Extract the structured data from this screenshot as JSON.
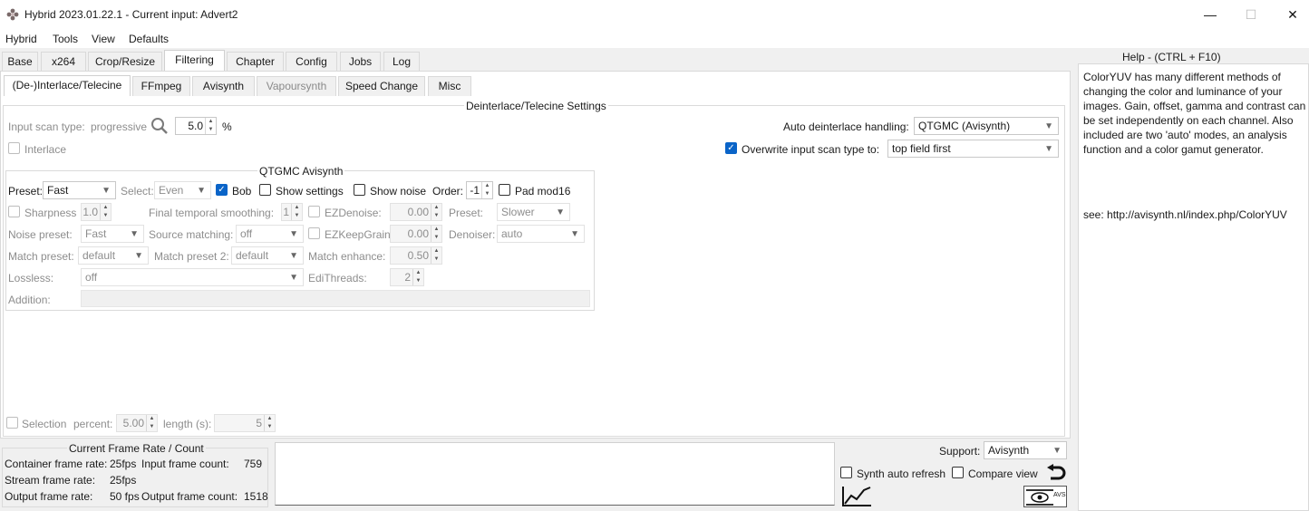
{
  "window": {
    "title": "Hybrid 2023.01.22.1 - Current input: Advert2",
    "minimize": "—",
    "maximize": "☐",
    "close": "✕"
  },
  "menu": [
    "Hybrid",
    "Tools",
    "View",
    "Defaults"
  ],
  "main_tabs": [
    "Base",
    "x264",
    "Crop/Resize",
    "Filtering",
    "Chapter",
    "Config",
    "Jobs",
    "Log"
  ],
  "sub_tabs": [
    "(De-)Interlace/Telecine",
    "FFmpeg",
    "Avisynth",
    "Vapoursynth",
    "Speed Change",
    "Misc"
  ],
  "deinterlace": {
    "title": "Deinterlace/Telecine Settings",
    "input_scan_label": "Input scan type:",
    "input_scan_value": "progressive",
    "zoom_value": "5.0",
    "percent": "%",
    "interlace_label": "Interlace",
    "auto_label": "Auto deinterlace handling:",
    "auto_value": "QTGMC (Avisynth)",
    "overwrite_label": "Overwrite input scan type to:",
    "overwrite_value": "top field first"
  },
  "qtgmc": {
    "title": "QTGMC Avisynth",
    "preset_label": "Preset:",
    "preset_value": "Fast",
    "select_label": "Select:",
    "select_value": "Even",
    "bob_label": "Bob",
    "show_settings_label": "Show settings",
    "show_noise_label": "Show noise",
    "order_label": "Order:",
    "order_value": "-1",
    "pad_label": "Pad mod16",
    "sharpness_label": "Sharpness",
    "sharpness_value": "1.0",
    "final_temporal_label": "Final temporal smoothing:",
    "final_temporal_value": "1",
    "ezdenoise_label": "EZDenoise:",
    "ezdenoise_value": "0.00",
    "preset2_label": "Preset:",
    "preset2_value": "Slower",
    "noise_preset_label": "Noise preset:",
    "noise_preset_value": "Fast",
    "source_matching_label": "Source matching:",
    "source_matching_value": "off",
    "ezkeepgrain_label": "EZKeepGrain:",
    "ezkeepgrain_value": "0.00",
    "denoiser_label": "Denoiser:",
    "denoiser_value": "auto",
    "match_preset_label": "Match preset:",
    "match_preset_value": "default",
    "match_preset2_label": "Match preset 2:",
    "match_preset2_value": "default",
    "match_enhance_label": "Match enhance:",
    "match_enhance_value": "0.50",
    "lossless_label": "Lossless:",
    "lossless_value": "off",
    "edithreads_label": "EdiThreads:",
    "edithreads_value": "2",
    "addition_label": "Addition:"
  },
  "selection": {
    "label": "Selection",
    "percent_label": "percent:",
    "percent_value": "5.00",
    "length_label": "length (s):",
    "length_value": "5"
  },
  "frame_rate": {
    "title": "Current Frame Rate / Count",
    "container_label": "Container frame rate:",
    "container_value": "25fps",
    "input_count_label": "Input frame count:",
    "input_count_value": "759",
    "stream_label": "Stream frame rate:",
    "stream_value": "25fps",
    "output_label": "Output frame rate:",
    "output_value": "50 fps",
    "output_count_label": "Output frame count:",
    "output_count_value": "1518"
  },
  "bottom_right": {
    "support_label": "Support:",
    "support_value": "Avisynth",
    "synth_refresh_label": "Synth auto refresh",
    "compare_label": "Compare view",
    "avs_label": "AVS"
  },
  "help": {
    "title": "Help - (CTRL + F10)",
    "text": "ColorYUV has many different methods of changing the color and luminance of your images. Gain, offset, gamma and contrast can be set independently on each channel. Also included are two 'auto' modes, an analysis function and a color gamut generator.",
    "see": "see: http://avisynth.nl/index.php/ColorYUV"
  },
  "colors": {
    "accent": "#0a64c8",
    "window_bg": "#f0f0f0",
    "panel_bg": "#ffffff"
  }
}
